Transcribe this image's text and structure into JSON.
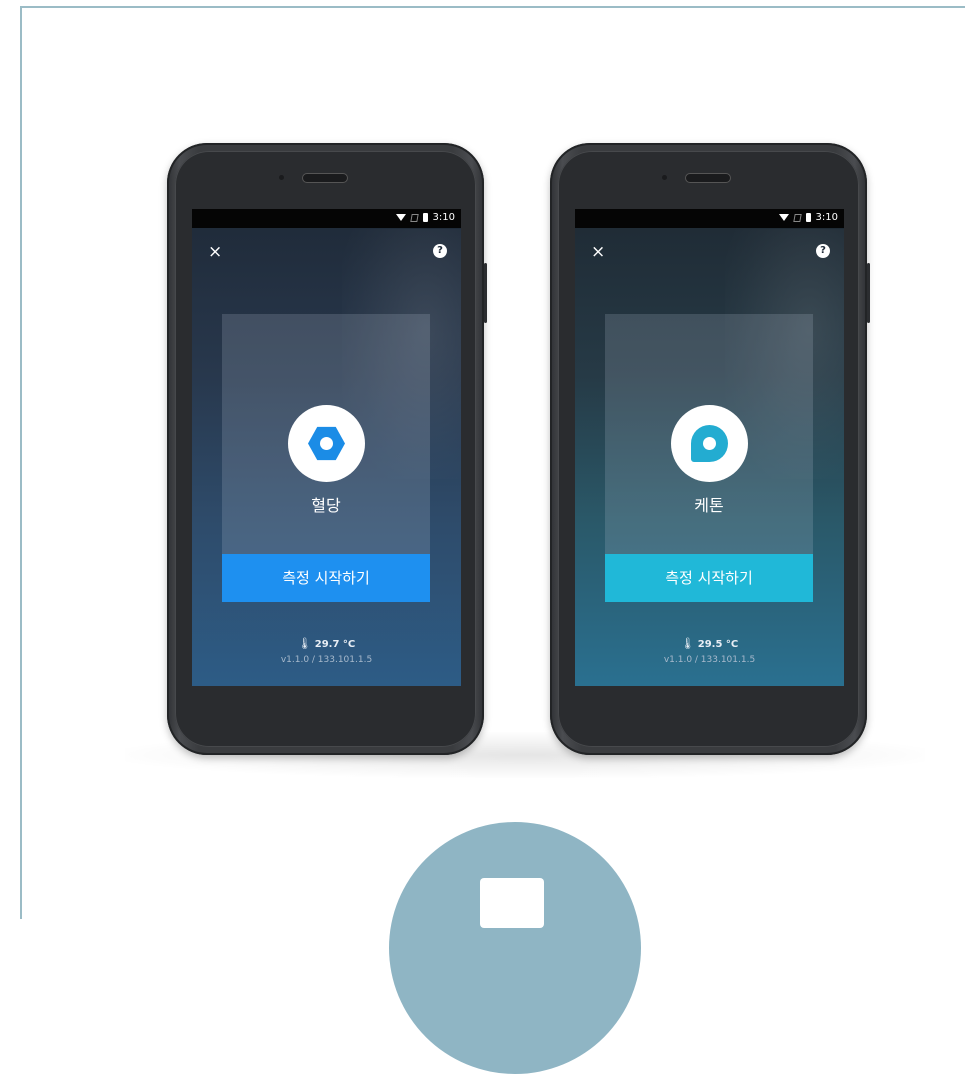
{
  "status_bar": {
    "time": "3:10"
  },
  "phones": [
    {
      "label": "혈당",
      "icon": "hexagon-icon",
      "accent": "#1e90f0",
      "button": "측정 시작하기",
      "temperature": "29.7 °C",
      "version": "v1.1.0 / 133.101.1.5"
    },
    {
      "label": "케톤",
      "icon": "drop-icon",
      "accent": "#20b8d8",
      "button": "측정 시작하기",
      "temperature": "29.5 °C",
      "version": "v1.1.0 / 133.101.1.5"
    }
  ],
  "icons": {
    "close": "×",
    "help": "?",
    "thermometer": "🌡"
  }
}
